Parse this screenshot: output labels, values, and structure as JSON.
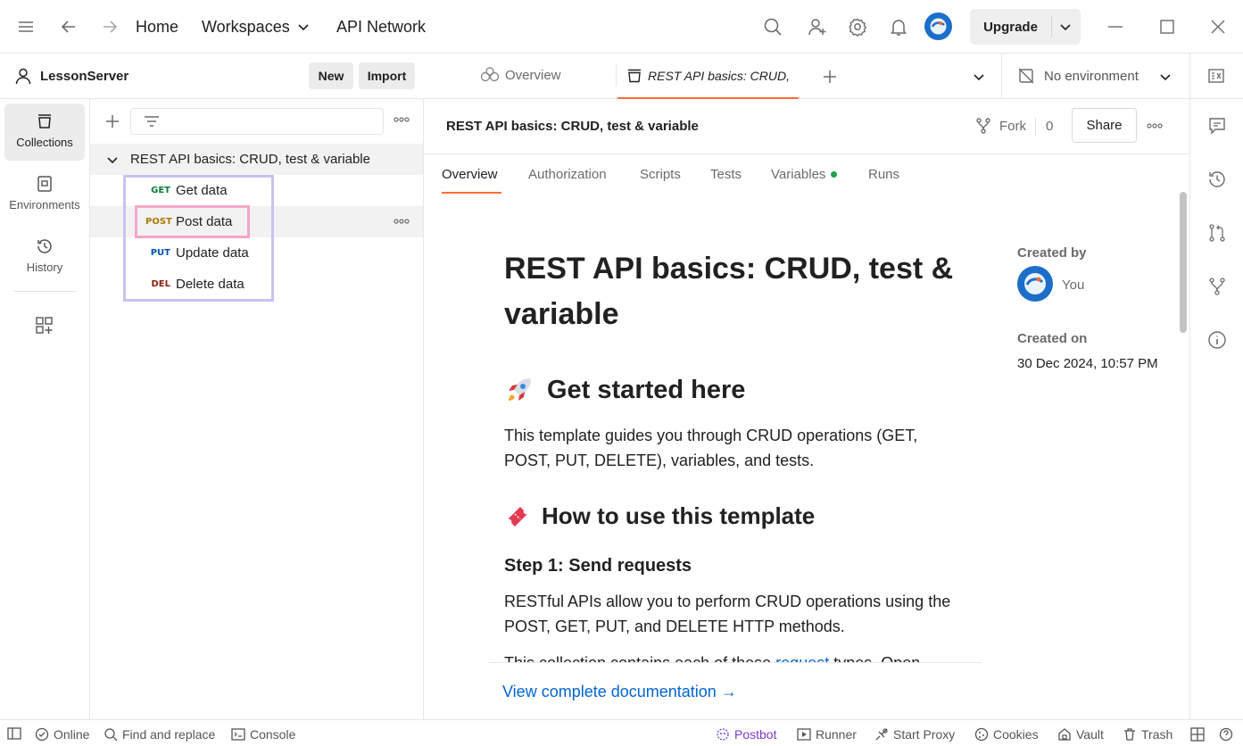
{
  "topbar": {
    "home": "Home",
    "workspaces": "Workspaces",
    "api_network": "API Network",
    "upgrade": "Upgrade"
  },
  "workspace": {
    "name": "LessonServer",
    "new_label": "New",
    "import_label": "Import"
  },
  "leftrail": {
    "collections": "Collections",
    "environments": "Environments",
    "history": "History"
  },
  "sidebar": {
    "collection_name": "REST API basics: CRUD, test & variable",
    "requests": [
      {
        "method": "GET",
        "label": "Get data",
        "color": "#0a7d3b"
      },
      {
        "method": "POST",
        "label": "Post data",
        "color": "#ad7a03"
      },
      {
        "method": "PUT",
        "label": "Update data",
        "color": "#0053b8"
      },
      {
        "method": "DEL",
        "label": "Delete data",
        "color": "#8e1a10"
      }
    ]
  },
  "tabs": {
    "overview": "Overview",
    "active": "REST API basics: CRUD,",
    "environment": "No environment"
  },
  "header": {
    "title": "REST API basics: CRUD, test & variable",
    "fork_label": "Fork",
    "fork_count": "0",
    "share_label": "Share"
  },
  "subtabs": [
    "Overview",
    "Authorization",
    "Scripts",
    "Tests",
    "Variables",
    "Runs"
  ],
  "doc": {
    "title": "REST API basics: CRUD, test & variable",
    "h2_get_started": "Get started here",
    "p1": "This template guides you through CRUD operations (GET, POST, PUT, DELETE), variables, and tests.",
    "h2_how_to": "How to use this template",
    "h3_step1": "Step 1: Send requests",
    "p2": "RESTful APIs allow you to perform CRUD operations using the POST, GET, PUT, and DELETE HTTP methods.",
    "p3_start": "This collection contains each of these ",
    "p3_link": "request",
    "p3_end": " types. Open",
    "view_docs": "View complete documentation →"
  },
  "meta": {
    "created_by_label": "Created by",
    "created_by": "You",
    "created_on_label": "Created on",
    "created_on": "30 Dec 2024, 10:57 PM"
  },
  "status": {
    "online": "Online",
    "find_replace": "Find and replace",
    "console": "Console",
    "postbot": "Postbot",
    "runner": "Runner",
    "start_proxy": "Start Proxy",
    "cookies": "Cookies",
    "vault": "Vault",
    "trash": "Trash"
  },
  "colors": {
    "accent": "#ff6c37",
    "link": "#0265d2",
    "purple_box": "#c9c2f0",
    "pink_box": "#f2a7c9",
    "postbot": "#7d3cc8"
  }
}
